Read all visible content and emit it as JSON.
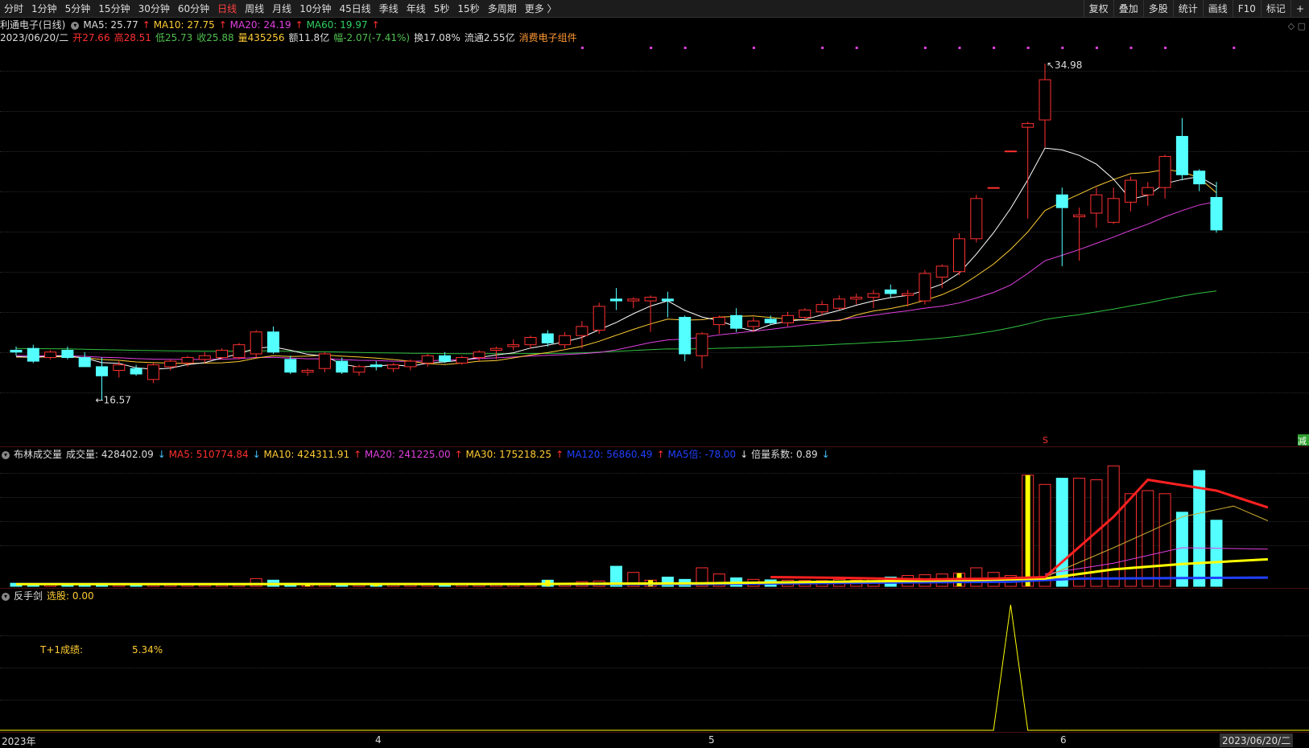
{
  "toolbar": {
    "periods": [
      "分时",
      "1分钟",
      "5分钟",
      "15分钟",
      "30分钟",
      "60分钟",
      "日线",
      "周线",
      "月线",
      "10分钟",
      "45日线",
      "季线",
      "年线",
      "5秒",
      "15秒",
      "多周期",
      "更多 〉"
    ],
    "active_index": 6,
    "right_items": [
      "复权",
      "叠加",
      "多股",
      "统计",
      "画线",
      "F10",
      "标记",
      "+"
    ]
  },
  "stock": {
    "name": "利通电子(日线)",
    "ma5": "MA5: 25.77",
    "ma10": "MA10: 27.75",
    "ma20": "MA20: 24.19",
    "ma60": "MA60: 19.97",
    "up_arrow": "↑",
    "down_arrow": "↓",
    "date": "2023/06/20/二",
    "open": "开27.66",
    "high": "高28.51",
    "low": "低25.73",
    "close": "收25.88",
    "volume": "量435256",
    "amount": "额11.8亿",
    "change": "幅-2.07(-7.41%)",
    "turnover": "换17.08%",
    "float_cap": "流通2.55亿",
    "sector": "消费电子组件",
    "top_icons": "◇ ▢"
  },
  "main_chart": {
    "max_label": "34.98",
    "min_label": "16.57",
    "s_label": "S",
    "jian_label": "减"
  },
  "vol_panel": {
    "title": "布林成交量",
    "vol": "成交量: 428402.09",
    "ma5": "MA5: 510774.84",
    "ma10": "MA10: 424311.91",
    "ma20": "MA20: 241225.00",
    "ma30": "MA30: 175218.25",
    "ma120": "MA120: 56860.49",
    "ma5d": "MA5倍: -78.00",
    "beiliang": "倍量系数: 0.89"
  },
  "ind_panel": {
    "title": "反手剑",
    "xuangu": "选股: 0.00",
    "t1_label": "T+1成绩:",
    "t1_value": "5.34%"
  },
  "xaxis": {
    "labels": [
      "2023年",
      "4",
      "5",
      "6"
    ],
    "current": "2023/06/20/二"
  },
  "colors": {
    "up": "#ff3030",
    "down": "#54ffff",
    "ma5": "#ffffff",
    "ma10": "#ffcc33",
    "ma20": "#e040e0",
    "ma60": "#30c040"
  },
  "chart_data": {
    "type": "candlestick",
    "price_axis": [
      16.57,
      34.98
    ],
    "candles": [
      {
        "o": 19.3,
        "h": 19.5,
        "l": 19.0,
        "c": 19.2
      },
      {
        "o": 19.4,
        "h": 19.6,
        "l": 18.6,
        "c": 18.7
      },
      {
        "o": 18.9,
        "h": 19.3,
        "l": 18.8,
        "c": 19.2
      },
      {
        "o": 19.3,
        "h": 19.5,
        "l": 18.8,
        "c": 18.9
      },
      {
        "o": 18.9,
        "h": 19.2,
        "l": 18.4,
        "c": 18.4
      },
      {
        "o": 18.4,
        "h": 18.9,
        "l": 16.57,
        "c": 17.9
      },
      {
        "o": 18.2,
        "h": 18.7,
        "l": 17.8,
        "c": 18.5
      },
      {
        "o": 18.3,
        "h": 18.5,
        "l": 17.9,
        "c": 18.0
      },
      {
        "o": 17.7,
        "h": 18.6,
        "l": 17.5,
        "c": 18.5
      },
      {
        "o": 18.4,
        "h": 18.8,
        "l": 18.2,
        "c": 18.7
      },
      {
        "o": 18.6,
        "h": 19.0,
        "l": 18.4,
        "c": 18.9
      },
      {
        "o": 18.8,
        "h": 19.2,
        "l": 18.6,
        "c": 19.0
      },
      {
        "o": 18.9,
        "h": 19.4,
        "l": 18.8,
        "c": 19.3
      },
      {
        "o": 18.9,
        "h": 19.7,
        "l": 18.8,
        "c": 19.6
      },
      {
        "o": 19.1,
        "h": 20.4,
        "l": 18.9,
        "c": 20.3
      },
      {
        "o": 20.3,
        "h": 20.6,
        "l": 19.1,
        "c": 19.2
      },
      {
        "o": 18.8,
        "h": 19.0,
        "l": 18.0,
        "c": 18.1
      },
      {
        "o": 18.1,
        "h": 18.3,
        "l": 17.9,
        "c": 18.2
      },
      {
        "o": 18.3,
        "h": 19.2,
        "l": 18.1,
        "c": 19.1
      },
      {
        "o": 18.7,
        "h": 18.9,
        "l": 18.0,
        "c": 18.1
      },
      {
        "o": 18.1,
        "h": 18.5,
        "l": 17.9,
        "c": 18.4
      },
      {
        "o": 18.5,
        "h": 18.7,
        "l": 18.2,
        "c": 18.4
      },
      {
        "o": 18.3,
        "h": 18.6,
        "l": 18.1,
        "c": 18.5
      },
      {
        "o": 18.4,
        "h": 18.8,
        "l": 18.2,
        "c": 18.7
      },
      {
        "o": 18.6,
        "h": 19.1,
        "l": 18.4,
        "c": 19.0
      },
      {
        "o": 19.0,
        "h": 19.2,
        "l": 18.6,
        "c": 18.7
      },
      {
        "o": 18.6,
        "h": 19.0,
        "l": 18.5,
        "c": 18.9
      },
      {
        "o": 18.9,
        "h": 19.3,
        "l": 18.7,
        "c": 19.2
      },
      {
        "o": 19.3,
        "h": 19.5,
        "l": 18.8,
        "c": 19.4
      },
      {
        "o": 19.5,
        "h": 19.9,
        "l": 19.3,
        "c": 19.6
      },
      {
        "o": 19.6,
        "h": 20.1,
        "l": 19.4,
        "c": 20.0
      },
      {
        "o": 20.2,
        "h": 20.4,
        "l": 19.5,
        "c": 19.7
      },
      {
        "o": 19.6,
        "h": 20.3,
        "l": 19.4,
        "c": 20.1
      },
      {
        "o": 20.1,
        "h": 20.9,
        "l": 19.4,
        "c": 20.6
      },
      {
        "o": 20.4,
        "h": 21.9,
        "l": 20.2,
        "c": 21.7
      },
      {
        "o": 22.1,
        "h": 22.7,
        "l": 21.5,
        "c": 22.0
      },
      {
        "o": 22.0,
        "h": 22.2,
        "l": 21.6,
        "c": 22.1
      },
      {
        "o": 22.0,
        "h": 22.3,
        "l": 20.3,
        "c": 22.2
      },
      {
        "o": 22.1,
        "h": 22.5,
        "l": 21.1,
        "c": 22.0
      },
      {
        "o": 21.1,
        "h": 21.2,
        "l": 18.7,
        "c": 19.1
      },
      {
        "o": 19.0,
        "h": 20.3,
        "l": 18.3,
        "c": 20.2
      },
      {
        "o": 20.7,
        "h": 21.2,
        "l": 20.2,
        "c": 21.1
      },
      {
        "o": 21.2,
        "h": 21.6,
        "l": 20.3,
        "c": 20.5
      },
      {
        "o": 20.6,
        "h": 21.1,
        "l": 20.3,
        "c": 20.9
      },
      {
        "o": 21.0,
        "h": 21.2,
        "l": 20.7,
        "c": 20.8
      },
      {
        "o": 20.8,
        "h": 21.4,
        "l": 20.6,
        "c": 21.2
      },
      {
        "o": 21.1,
        "h": 21.6,
        "l": 20.9,
        "c": 21.5
      },
      {
        "o": 21.4,
        "h": 22.0,
        "l": 21.2,
        "c": 21.8
      },
      {
        "o": 21.6,
        "h": 22.3,
        "l": 21.5,
        "c": 22.1
      },
      {
        "o": 22.1,
        "h": 22.4,
        "l": 21.8,
        "c": 22.2
      },
      {
        "o": 22.2,
        "h": 22.6,
        "l": 21.6,
        "c": 22.4
      },
      {
        "o": 22.6,
        "h": 22.9,
        "l": 22.2,
        "c": 22.4
      },
      {
        "o": 22.3,
        "h": 22.6,
        "l": 21.7,
        "c": 22.4
      },
      {
        "o": 22.0,
        "h": 23.7,
        "l": 21.8,
        "c": 23.5
      },
      {
        "o": 23.3,
        "h": 24.0,
        "l": 22.7,
        "c": 23.9
      },
      {
        "o": 23.6,
        "h": 25.7,
        "l": 23.4,
        "c": 25.4
      },
      {
        "o": 25.4,
        "h": 27.8,
        "l": 25.2,
        "c": 27.6
      },
      {
        "o": 28.2,
        "h": 28.2,
        "l": 28.2,
        "c": 28.2
      },
      {
        "o": 30.2,
        "h": 30.2,
        "l": 30.2,
        "c": 30.2
      },
      {
        "o": 31.5,
        "h": 31.8,
        "l": 26.5,
        "c": 31.7
      },
      {
        "o": 31.9,
        "h": 34.98,
        "l": 30.4,
        "c": 34.1
      },
      {
        "o": 27.8,
        "h": 28.2,
        "l": 23.9,
        "c": 27.1
      },
      {
        "o": 26.6,
        "h": 27.1,
        "l": 24.2,
        "c": 26.7
      },
      {
        "o": 26.8,
        "h": 28.2,
        "l": 26.0,
        "c": 27.8
      },
      {
        "o": 26.3,
        "h": 28.2,
        "l": 26.2,
        "c": 27.6
      },
      {
        "o": 27.4,
        "h": 28.8,
        "l": 26.9,
        "c": 28.6
      },
      {
        "o": 27.8,
        "h": 28.5,
        "l": 27.2,
        "c": 28.2
      },
      {
        "o": 28.2,
        "h": 30.0,
        "l": 27.6,
        "c": 29.9
      },
      {
        "o": 31.0,
        "h": 32.0,
        "l": 28.6,
        "c": 28.9
      },
      {
        "o": 29.1,
        "h": 29.2,
        "l": 28.0,
        "c": 28.4
      },
      {
        "o": 27.66,
        "h": 28.51,
        "l": 25.73,
        "c": 25.88
      }
    ],
    "vol_axis_max": 750000,
    "volumes": [
      20000,
      18000,
      16000,
      15000,
      17000,
      20000,
      15000,
      14000,
      14000,
      16000,
      15000,
      15000,
      14000,
      13000,
      50000,
      40000,
      20000,
      17000,
      18000,
      16000,
      16000,
      15000,
      14000,
      14000,
      15000,
      14000,
      16000,
      14000,
      15000,
      16000,
      17000,
      40000,
      20000,
      30000,
      34000,
      130000,
      90000,
      40000,
      60000,
      45000,
      120000,
      80000,
      55000,
      45000,
      42000,
      40000,
      38000,
      37000,
      45000,
      40000,
      50000,
      60000,
      70000,
      75000,
      80000,
      85000,
      120000,
      90000,
      70000,
      720000,
      660000,
      700000,
      700000,
      690000,
      780000,
      600000,
      620000,
      600000,
      480000,
      750000,
      428402
    ],
    "vol_ma5_line": [
      [
        44,
        60000
      ],
      [
        48,
        55000
      ],
      [
        53,
        45000
      ],
      [
        57,
        50000
      ],
      [
        60,
        60000
      ],
      [
        64,
        450000
      ],
      [
        66,
        690000
      ],
      [
        70,
        620000
      ],
      [
        73,
        510774
      ]
    ],
    "vol_ma20_line": [
      [
        60,
        80000
      ],
      [
        64,
        150000
      ],
      [
        68,
        250000
      ],
      [
        73,
        241225
      ]
    ],
    "vol_ma30_line": [
      [
        0,
        14000
      ],
      [
        30,
        15000
      ],
      [
        40,
        20000
      ],
      [
        56,
        40000
      ],
      [
        60,
        50000
      ],
      [
        64,
        110000
      ],
      [
        68,
        145000
      ],
      [
        73,
        175218
      ]
    ],
    "vol_ma120_line": [
      [
        0,
        15000
      ],
      [
        40,
        15000
      ],
      [
        58,
        30000
      ],
      [
        62,
        50000
      ],
      [
        73,
        56860
      ]
    ],
    "vol_ma10_line": [
      [
        60,
        60000
      ],
      [
        64,
        250000
      ],
      [
        68,
        450000
      ],
      [
        71,
        520000
      ],
      [
        73,
        424311
      ]
    ],
    "ind_spike_index": 58,
    "ind_spike_value": 1
  }
}
